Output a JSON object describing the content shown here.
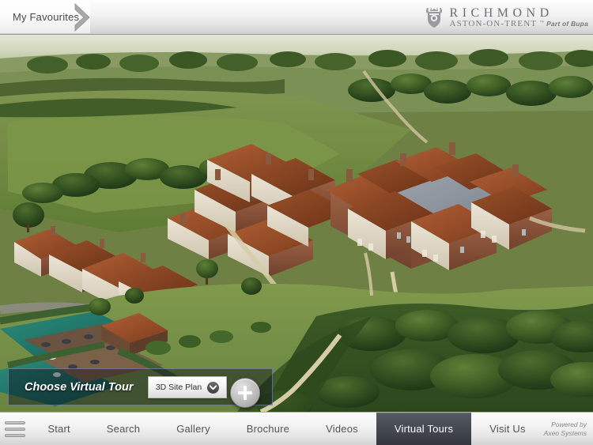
{
  "header": {
    "favourites_label": "My Favourites",
    "favourites_icon": "chevron-right-icon",
    "brand": {
      "crest_icon": "heraldic-crest-icon",
      "name": "RICHMOND",
      "location": "ASTON-ON-TRENT",
      "trademark": "™",
      "affiliation": "Part of Bupa"
    }
  },
  "stage": {
    "alt": "3D aerial site plan render of Richmond Aston-on-Trent retirement village",
    "colors": {
      "sky": "#d8dcc8",
      "grass_light": "#7d9447",
      "grass_mid": "#617f38",
      "grass_dark": "#3d5622",
      "woodland": "#2f4a1e",
      "roof_terracotta": "#a0522d",
      "roof_terracotta_dark": "#7d3e21",
      "wall_brick": "#8d5a42",
      "wall_cream": "#ded6c6",
      "roof_slate": "#8f96a0",
      "path_sand": "#d9cfa8",
      "tarmac": "#8e8c86",
      "water_teal": "#1f7a6d"
    }
  },
  "tour_controls": {
    "label": "Choose Virtual Tour",
    "select": {
      "value": "3D Site Plan",
      "icon": "chevron-down-icon",
      "options": [
        "3D Site Plan"
      ]
    },
    "add_button": {
      "icon": "plus-icon",
      "label": "+"
    }
  },
  "bottom_nav": {
    "menu_icon": "hamburger-menu-icon",
    "items": [
      {
        "label": "Start",
        "active": false
      },
      {
        "label": "Search",
        "active": false
      },
      {
        "label": "Gallery",
        "active": false
      },
      {
        "label": "Brochure",
        "active": false
      },
      {
        "label": "Videos",
        "active": false
      },
      {
        "label": "Virtual Tours",
        "active": true
      },
      {
        "label": "Visit Us",
        "active": false
      }
    ],
    "powered_by_line1": "Powered by",
    "powered_by_line2": "Axeo Systems"
  }
}
